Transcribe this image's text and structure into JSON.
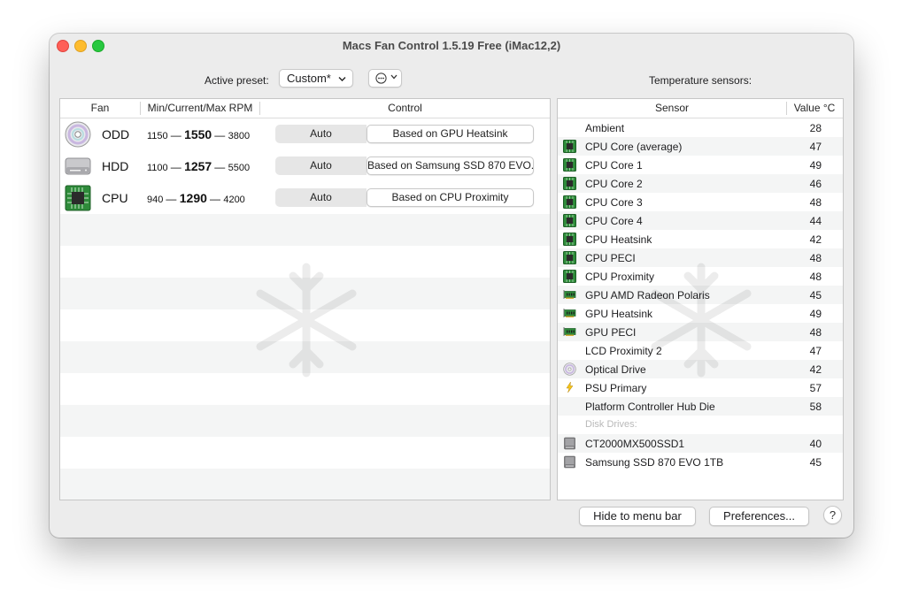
{
  "window": {
    "title": "Macs Fan Control 1.5.19 Free (iMac12,2)"
  },
  "preset": {
    "label": "Active preset:",
    "value": "Custom*"
  },
  "temperature_label": "Temperature sensors:",
  "fan_table": {
    "headers": [
      "Fan",
      "Min/Current/Max RPM",
      "Control"
    ],
    "rows": [
      {
        "name": "ODD",
        "icon": "optical-disc-icon",
        "min": "1150",
        "current": "1550",
        "max": "3800",
        "auto_label": "Auto",
        "control": "Based on GPU Heatsink"
      },
      {
        "name": "HDD",
        "icon": "hard-drive-icon",
        "min": "1100",
        "current": "1257",
        "max": "5500",
        "auto_label": "Auto",
        "control": "Based on Samsung SSD 870 EVO..."
      },
      {
        "name": "CPU",
        "icon": "cpu-chip-icon",
        "min": "940",
        "current": "1290",
        "max": "4200",
        "auto_label": "Auto",
        "control": "Based on CPU Proximity"
      }
    ]
  },
  "sensor_table": {
    "headers": [
      "Sensor",
      "Value °C"
    ],
    "rows": [
      {
        "name": "Ambient",
        "value": "28",
        "icon": ""
      },
      {
        "name": "CPU Core (average)",
        "value": "47",
        "icon": "cpu-chip-icon"
      },
      {
        "name": "CPU Core 1",
        "value": "49",
        "icon": "cpu-chip-icon"
      },
      {
        "name": "CPU Core 2",
        "value": "46",
        "icon": "cpu-chip-icon"
      },
      {
        "name": "CPU Core 3",
        "value": "48",
        "icon": "cpu-chip-icon"
      },
      {
        "name": "CPU Core 4",
        "value": "44",
        "icon": "cpu-chip-icon"
      },
      {
        "name": "CPU Heatsink",
        "value": "42",
        "icon": "cpu-chip-icon"
      },
      {
        "name": "CPU PECI",
        "value": "48",
        "icon": "cpu-chip-icon"
      },
      {
        "name": "CPU Proximity",
        "value": "48",
        "icon": "cpu-chip-icon"
      },
      {
        "name": "GPU AMD Radeon Polaris",
        "value": "45",
        "icon": "gpu-card-icon"
      },
      {
        "name": "GPU Heatsink",
        "value": "49",
        "icon": "gpu-card-icon"
      },
      {
        "name": "GPU PECI",
        "value": "48",
        "icon": "gpu-card-icon"
      },
      {
        "name": "LCD Proximity 2",
        "value": "47",
        "icon": ""
      },
      {
        "name": "Optical Drive",
        "value": "42",
        "icon": "optical-disc-icon"
      },
      {
        "name": "PSU Primary",
        "value": "57",
        "icon": "power-bolt-icon"
      },
      {
        "name": "Platform Controller Hub Die",
        "value": "58",
        "icon": ""
      },
      {
        "name": "Disk Drives:",
        "value": "",
        "icon": "",
        "section": true
      },
      {
        "name": "CT2000MX500SSD1",
        "value": "40",
        "icon": "disk-drive-icon"
      },
      {
        "name": "Samsung SSD 870 EVO 1TB",
        "value": "45",
        "icon": "disk-drive-icon"
      }
    ]
  },
  "buttons": {
    "hide": "Hide to menu bar",
    "preferences": "Preferences...",
    "help": "?"
  },
  "colors": {
    "close": "#ff5f57",
    "minimize": "#febc2e",
    "maximize": "#28c840",
    "chip_green": "#2e8b3a"
  }
}
